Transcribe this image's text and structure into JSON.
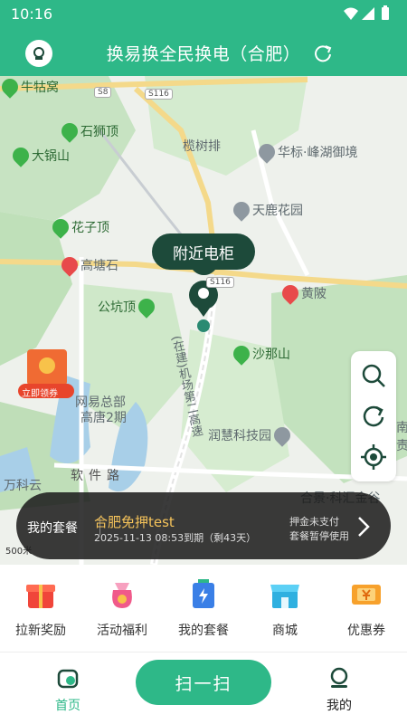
{
  "status_bar": {
    "time": "10:16"
  },
  "header": {
    "title": "换易换全民换电（合肥）"
  },
  "map": {
    "nearby_label": "附近电柜",
    "places": {
      "niugu": "牛牯窝",
      "shishi": "石狮顶",
      "daguo": "大锅山",
      "lanshupai": "榄树排",
      "huabiao": "华标·峰湖御境",
      "tianlu": "天鹿花园",
      "huazi": "花子顶",
      "gaotang": "高塘石",
      "huangpo": "黄陂",
      "gongkeng": "公坑顶",
      "shana": "沙那山",
      "wangyi1": "网易总部",
      "wangyi2": "高唐2期",
      "runhui": "润慧科技园",
      "ruanjian": "软件路",
      "zaijian": "(在建)机场第二高速",
      "wanke": "万科云",
      "hefei": "合景·科汇金谷",
      "nan": "南",
      "ze": "责"
    },
    "road_shields": {
      "s8": "S8",
      "s116a": "S116",
      "s116b": "S116"
    },
    "promo_label": "立即领券",
    "scale": "500米"
  },
  "package": {
    "label": "我的套餐",
    "title": "合肥免押test",
    "expiry": "2025-11-13 08:53到期（剩43天）",
    "status_line1": "押金未支付",
    "status_line2": "套餐暂停使用"
  },
  "shortcuts": [
    {
      "label": "拉新奖励",
      "icon": "gift-icon"
    },
    {
      "label": "活动福利",
      "icon": "money-bag-icon"
    },
    {
      "label": "我的套餐",
      "icon": "battery-package-icon"
    },
    {
      "label": "商城",
      "icon": "shop-icon"
    },
    {
      "label": "优惠券",
      "icon": "coupon-icon"
    }
  ],
  "nav": {
    "home": "首页",
    "scan": "扫一扫",
    "mine": "我的"
  },
  "colors": {
    "primary": "#2eb888",
    "banner_accent": "#f5c35a"
  }
}
